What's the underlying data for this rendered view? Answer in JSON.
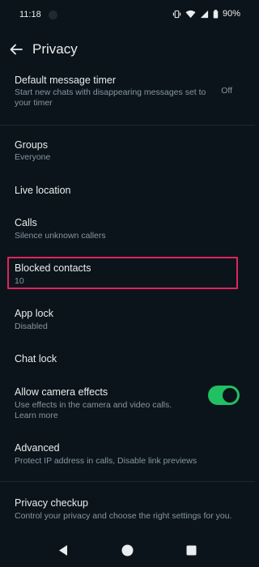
{
  "status_bar": {
    "time": "11:18",
    "battery": "90%"
  },
  "header": {
    "title": "Privacy"
  },
  "settings": {
    "message_timer": {
      "label": "Default message timer",
      "description": "Start new chats with disappearing messages set to your timer",
      "value": "Off"
    },
    "groups": {
      "label": "Groups",
      "value": "Everyone"
    },
    "live_location": {
      "label": "Live location"
    },
    "calls": {
      "label": "Calls",
      "value": "Silence unknown callers"
    },
    "blocked_contacts": {
      "label": "Blocked contacts",
      "value": "10"
    },
    "app_lock": {
      "label": "App lock",
      "value": "Disabled"
    },
    "chat_lock": {
      "label": "Chat lock"
    },
    "camera_effects": {
      "label": "Allow camera effects",
      "description": "Use effects in the camera and video calls.",
      "link": "Learn more",
      "enabled": true
    },
    "advanced": {
      "label": "Advanced",
      "description": "Protect IP address in calls, Disable link previews"
    },
    "privacy_checkup": {
      "label": "Privacy checkup",
      "description": "Control your privacy and choose the right settings for you."
    }
  },
  "colors": {
    "background": "#0b141a",
    "accent_green": "#21c063",
    "link_blue": "#53bdeb",
    "highlight_border": "#e0245e"
  },
  "icons": [
    "vibrate-icon",
    "wifi-icon",
    "signal-icon",
    "battery-icon",
    "back-arrow-icon",
    "nav-back-icon",
    "nav-home-icon",
    "nav-recents-icon"
  ]
}
